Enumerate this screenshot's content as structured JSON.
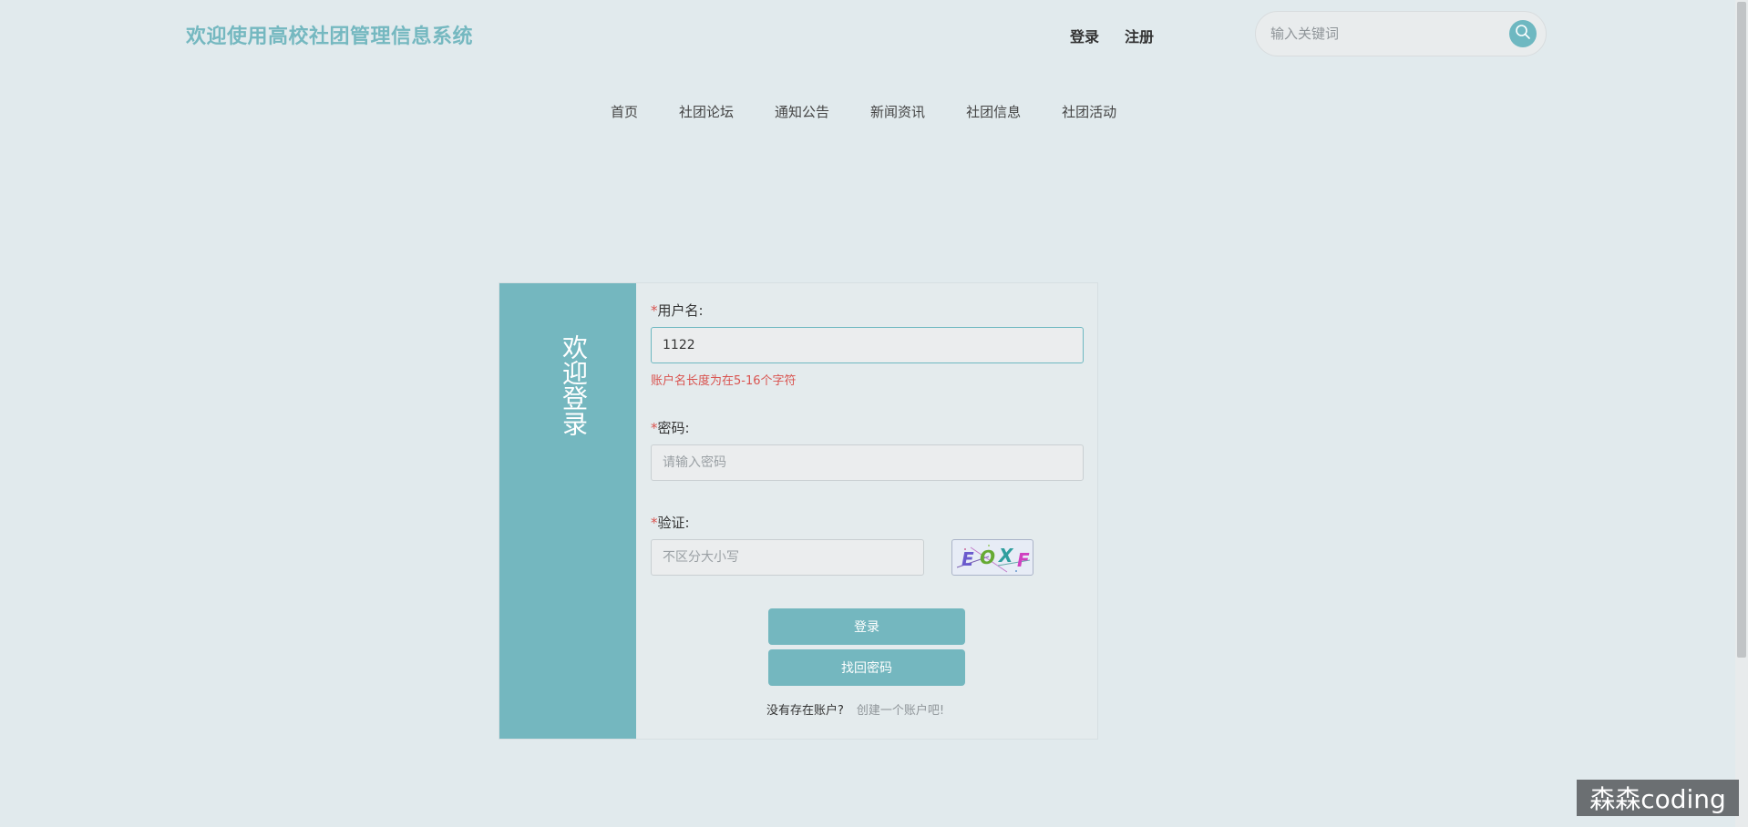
{
  "header": {
    "title": "欢迎使用高校社团管理信息系统",
    "login_label": "登录",
    "register_label": "注册",
    "search_placeholder": "输入关键词"
  },
  "nav": {
    "items": [
      "首页",
      "社团论坛",
      "通知公告",
      "新闻资讯",
      "社团信息",
      "社团活动"
    ]
  },
  "login_card": {
    "side_title": "欢迎登录",
    "username": {
      "label": "用户名:",
      "value": "1122",
      "error": "账户名长度为在5-16个字符"
    },
    "password": {
      "label": "密码:",
      "placeholder": "请输入密码"
    },
    "captcha": {
      "label": "验证:",
      "placeholder": "不区分大小写",
      "code": "EOXF"
    },
    "required_mark": "*",
    "login_button": "登录",
    "recover_button": "找回密码",
    "no_account_text": "没有存在账户?",
    "create_account_link": "创建一个账户吧!"
  },
  "watermark": "森森coding",
  "colors": {
    "accent": "#74b7bf",
    "background": "#e1eaed",
    "error": "#d9534f"
  }
}
